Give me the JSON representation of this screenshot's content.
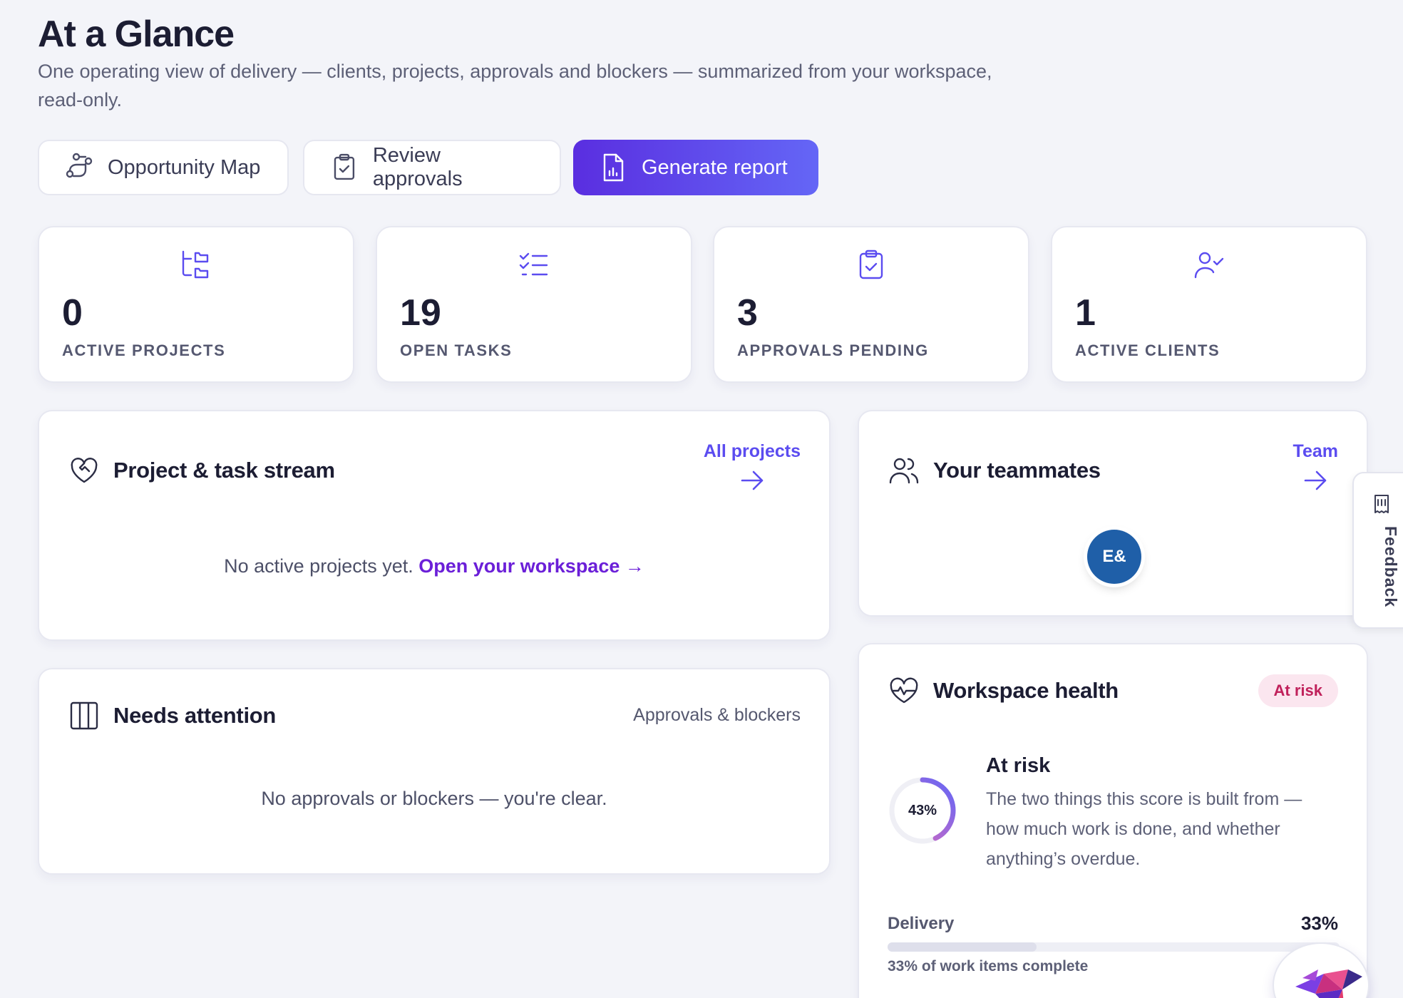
{
  "header": {
    "title": "At a Glance",
    "subtitle": "One operating view of delivery — clients, projects, approvals and blockers — summarized from your workspace, read-only."
  },
  "actions": {
    "opportunity_map": "Opportunity Map",
    "review_approvals": "Review approvals",
    "generate_report": "Generate report"
  },
  "stats": [
    {
      "value": "0",
      "label": "ACTIVE PROJECTS",
      "icon": "folders-icon"
    },
    {
      "value": "19",
      "label": "OPEN TASKS",
      "icon": "checklist-icon"
    },
    {
      "value": "3",
      "label": "APPROVALS PENDING",
      "icon": "clipboard-check-icon"
    },
    {
      "value": "1",
      "label": "ACTIVE CLIENTS",
      "icon": "user-check-icon"
    }
  ],
  "project_stream": {
    "title": "Project & task stream",
    "link": "All projects",
    "empty_text": "No active projects yet.",
    "empty_link": "Open your workspace →"
  },
  "teammates": {
    "title": "Your teammates",
    "link": "Team",
    "avatar_initials": "E&"
  },
  "needs_attention": {
    "title": "Needs attention",
    "subtitle": "Approvals & blockers",
    "empty_text": "No approvals or blockers — you're clear."
  },
  "health": {
    "title": "Workspace health",
    "badge": "At risk",
    "score_label": "43%",
    "score_value": 43,
    "status": "At risk",
    "description": "The two things this score is built from — how much work is done, and whether anything’s overdue.",
    "delivery_label": "Delivery",
    "delivery_value_label": "33%",
    "delivery_value": 33,
    "delivery_caption": "33% of work items complete"
  },
  "feedback_tab": "Feedback",
  "colors": {
    "accent": "#5b4cf0",
    "primary_gradient_start": "#5a2ee0",
    "primary_gradient_end": "#6466f6",
    "danger": "#c0215b",
    "avatar": "#1f5fa8"
  }
}
